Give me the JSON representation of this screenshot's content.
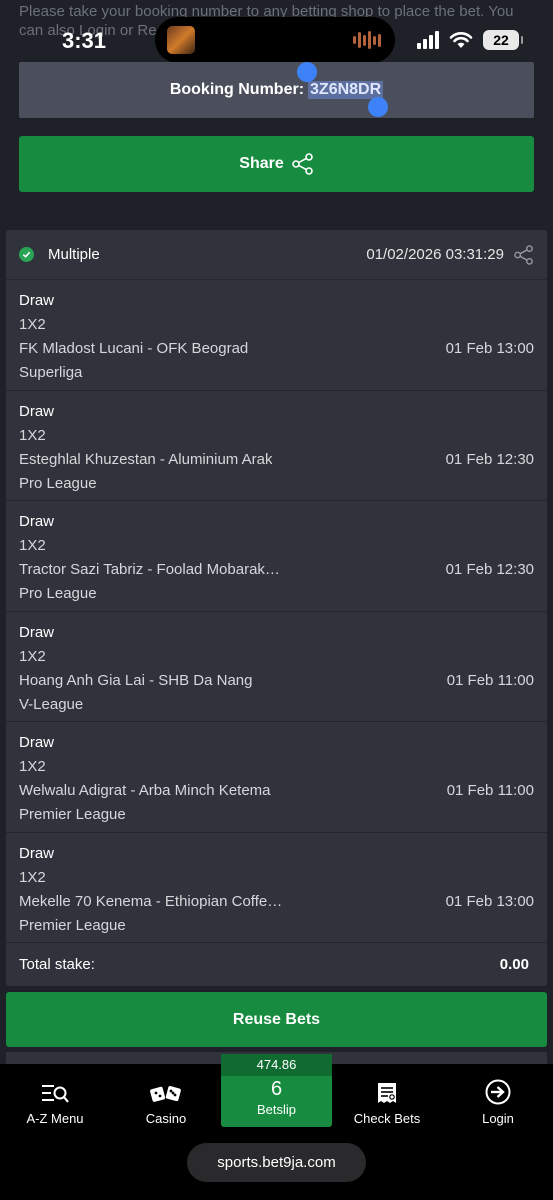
{
  "top_note": "Please take your booking number to any betting shop to place the bet. You can also Login or Re",
  "status_bar": {
    "time": "3:31",
    "battery": "22"
  },
  "booking": {
    "label": "Booking Number:",
    "code": "3Z6N8DR"
  },
  "share_button": {
    "label": "Share"
  },
  "bet": {
    "type": "Multiple",
    "datetime": "01/02/2026 03:31:29",
    "selections": [
      {
        "pick": "Draw",
        "market": "1X2",
        "match": "FK Mladost Lucani - OFK Beograd",
        "time": "01 Feb 13:00",
        "league": "Superliga"
      },
      {
        "pick": "Draw",
        "market": "1X2",
        "match": "Esteghlal Khuzestan - Aluminium Arak",
        "time": "01 Feb 12:30",
        "league": "Pro League"
      },
      {
        "pick": "Draw",
        "market": "1X2",
        "match": "Tractor Sazi Tabriz - Foolad Mobarak…",
        "time": "01 Feb 12:30",
        "league": "Pro League"
      },
      {
        "pick": "Draw",
        "market": "1X2",
        "match": "Hoang Anh Gia Lai - SHB Da Nang",
        "time": "01 Feb 11:00",
        "league": "V-League"
      },
      {
        "pick": "Draw",
        "market": "1X2",
        "match": "Welwalu Adigrat - Arba Minch Ketema",
        "time": "01 Feb 11:00",
        "league": "Premier League"
      },
      {
        "pick": "Draw",
        "market": "1X2",
        "match": "Mekelle 70 Kenema - Ethiopian Coffe…",
        "time": "01 Feb 13:00",
        "league": "Premier League"
      }
    ],
    "total_stake_label": "Total stake:",
    "total_stake": "0.00"
  },
  "reuse_button": {
    "label": "Reuse Bets"
  },
  "nav": {
    "az_menu": "A-Z Menu",
    "casino": "Casino",
    "betslip": {
      "odds": "474.86",
      "count": "6",
      "label": "Betslip"
    },
    "check_bets": "Check Bets",
    "login": "Login"
  },
  "url": "sports.bet9ja.com",
  "colors": {
    "accent_green": "#178b3f",
    "background": "#1e2127",
    "card": "#30333c"
  }
}
